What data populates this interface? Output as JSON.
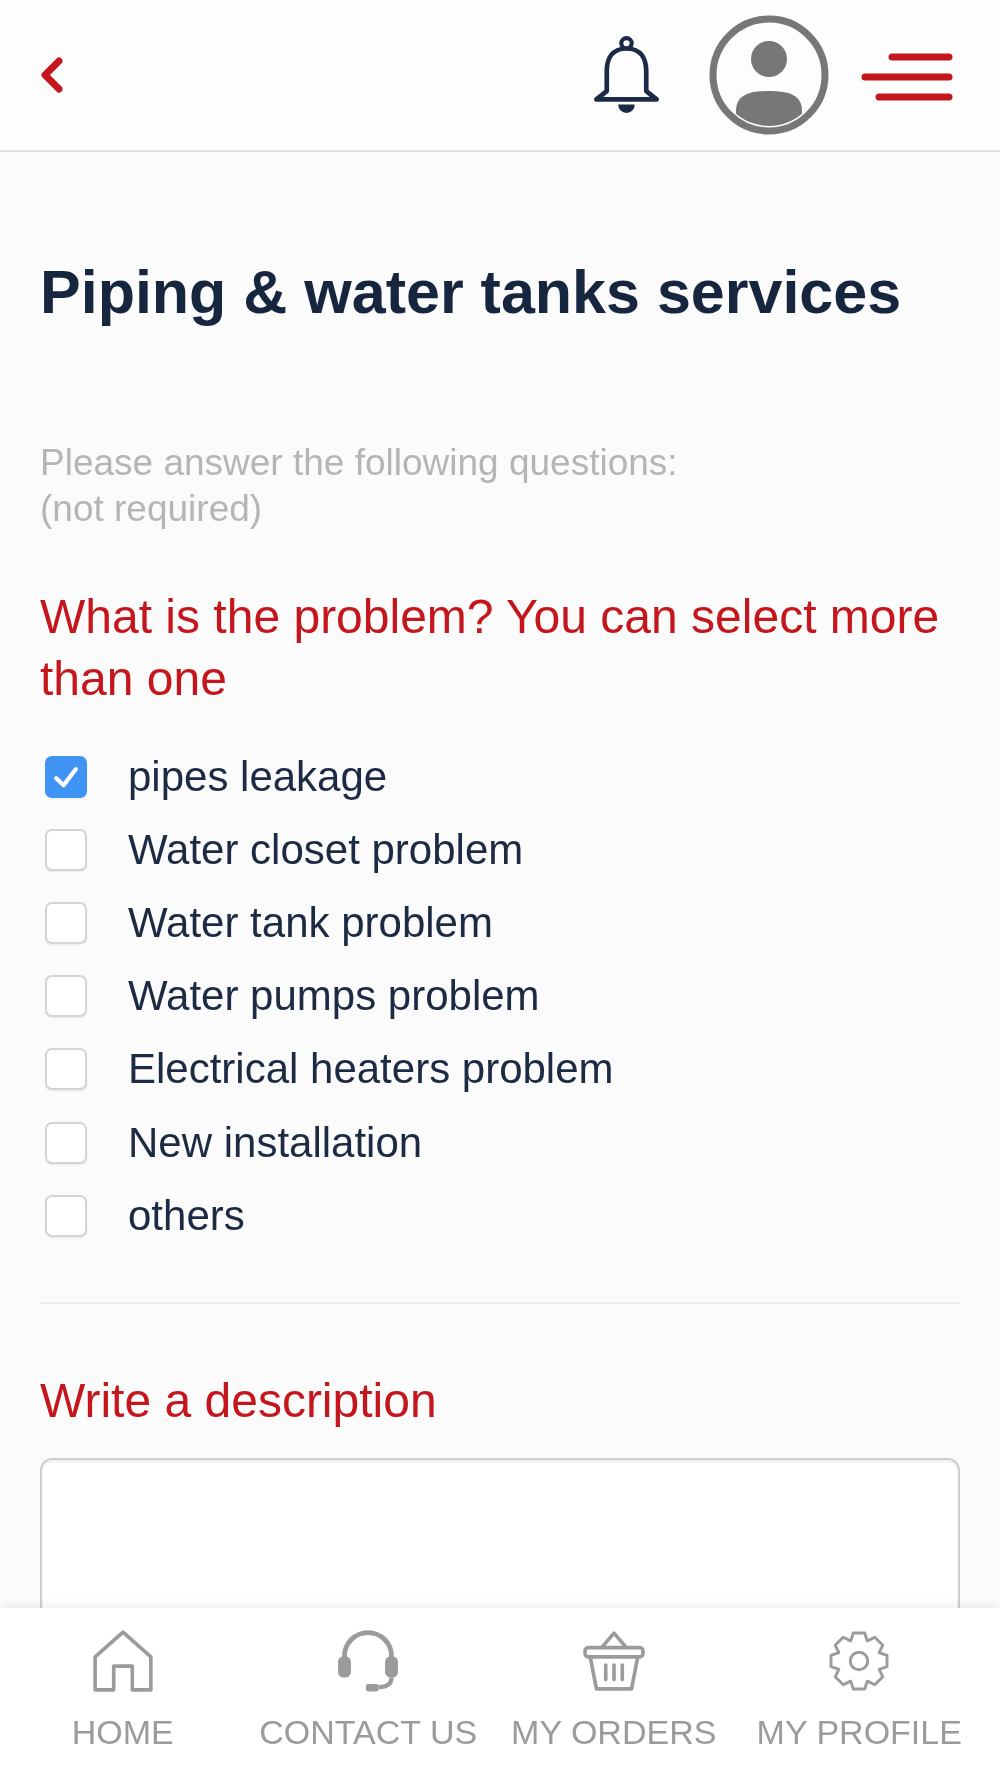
{
  "page": {
    "title": "Piping & water tanks services",
    "intro": "Please answer the following questions:",
    "note": "(not required)"
  },
  "question": {
    "prompt": "What is the problem? You can select more than one",
    "options": [
      {
        "label": "pipes leakage",
        "checked": true
      },
      {
        "label": "Water closet problem",
        "checked": false
      },
      {
        "label": "Water tank problem",
        "checked": false
      },
      {
        "label": "Water pumps problem",
        "checked": false
      },
      {
        "label": "Electrical heaters problem",
        "checked": false
      },
      {
        "label": "New installation",
        "checked": false
      },
      {
        "label": "others",
        "checked": false
      }
    ]
  },
  "description": {
    "label": "Write a description"
  },
  "bottom_nav": [
    {
      "kind": "home",
      "label": "HOME",
      "selected": false
    },
    {
      "kind": "headset",
      "label": "CONTACT US",
      "selected": false
    },
    {
      "kind": "basket",
      "label": "MY ORDERS",
      "selected": false
    },
    {
      "kind": "gear",
      "label": "MY PROFILE",
      "selected": false
    }
  ]
}
